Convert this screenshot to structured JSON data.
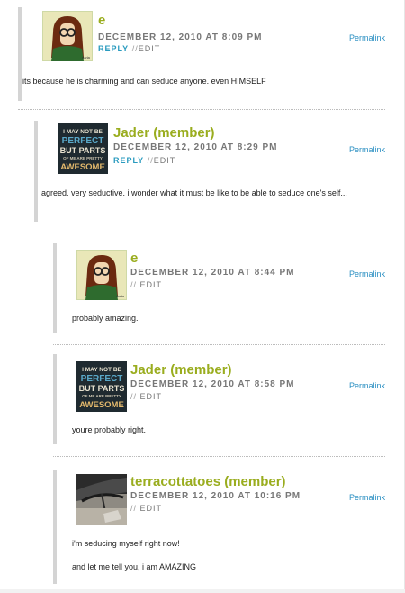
{
  "comments": [
    {
      "author": "e",
      "date": "DECEMBER 12, 2010 AT 8:09 PM",
      "reply": "REPLY",
      "sep": "//",
      "edit": "EDIT",
      "permalink": "Permalink",
      "avatar": "daria-avatar",
      "body": [
        "its because he is charming and can seduce anyone. even HIMSELF"
      ]
    },
    {
      "author": "Jader (member)",
      "date": "DECEMBER 12, 2010 AT 8:29 PM",
      "reply": "REPLY",
      "sep": "//",
      "edit": "EDIT",
      "permalink": "Permalink",
      "avatar": "awesome-poster-avatar",
      "avatar_text": [
        "I MAY NOT BE",
        "PERFECT",
        "BUT PARTS",
        "OF ME ARE PRETTY",
        "AWESOME"
      ],
      "body": [
        "agreed. very seductive. i wonder what it must be like to be able to seduce one's self..."
      ]
    },
    {
      "author": "e",
      "date": "DECEMBER 12, 2010 AT 8:44 PM",
      "sep": "//",
      "edit": "EDIT",
      "permalink": "Permalink",
      "avatar": "daria-avatar",
      "body": [
        "probably amazing."
      ]
    },
    {
      "author": "Jader (member)",
      "date": "DECEMBER 12, 2010 AT 8:58 PM",
      "sep": "//",
      "edit": "EDIT",
      "permalink": "Permalink",
      "avatar": "awesome-poster-avatar",
      "avatar_text": [
        "I MAY NOT BE",
        "PERFECT",
        "BUT PARTS",
        "OF ME ARE PRETTY",
        "AWESOME"
      ],
      "body": [
        "youre probably right."
      ]
    },
    {
      "author": "terracottatoes (member)",
      "date": "DECEMBER 12, 2010 AT 10:16 PM",
      "sep": "//",
      "edit": "EDIT",
      "permalink": "Permalink",
      "avatar": "umbrella-photo-avatar",
      "body": [
        "i'm seducing myself right now!",
        "and let me tell you, i am AMAZING"
      ]
    }
  ],
  "colors": {
    "author": "#9aad1f",
    "reply": "#2a9bbf",
    "permalink": "#2a8fc2",
    "meta": "#777777",
    "thread_bar": "#d4d4d4"
  }
}
